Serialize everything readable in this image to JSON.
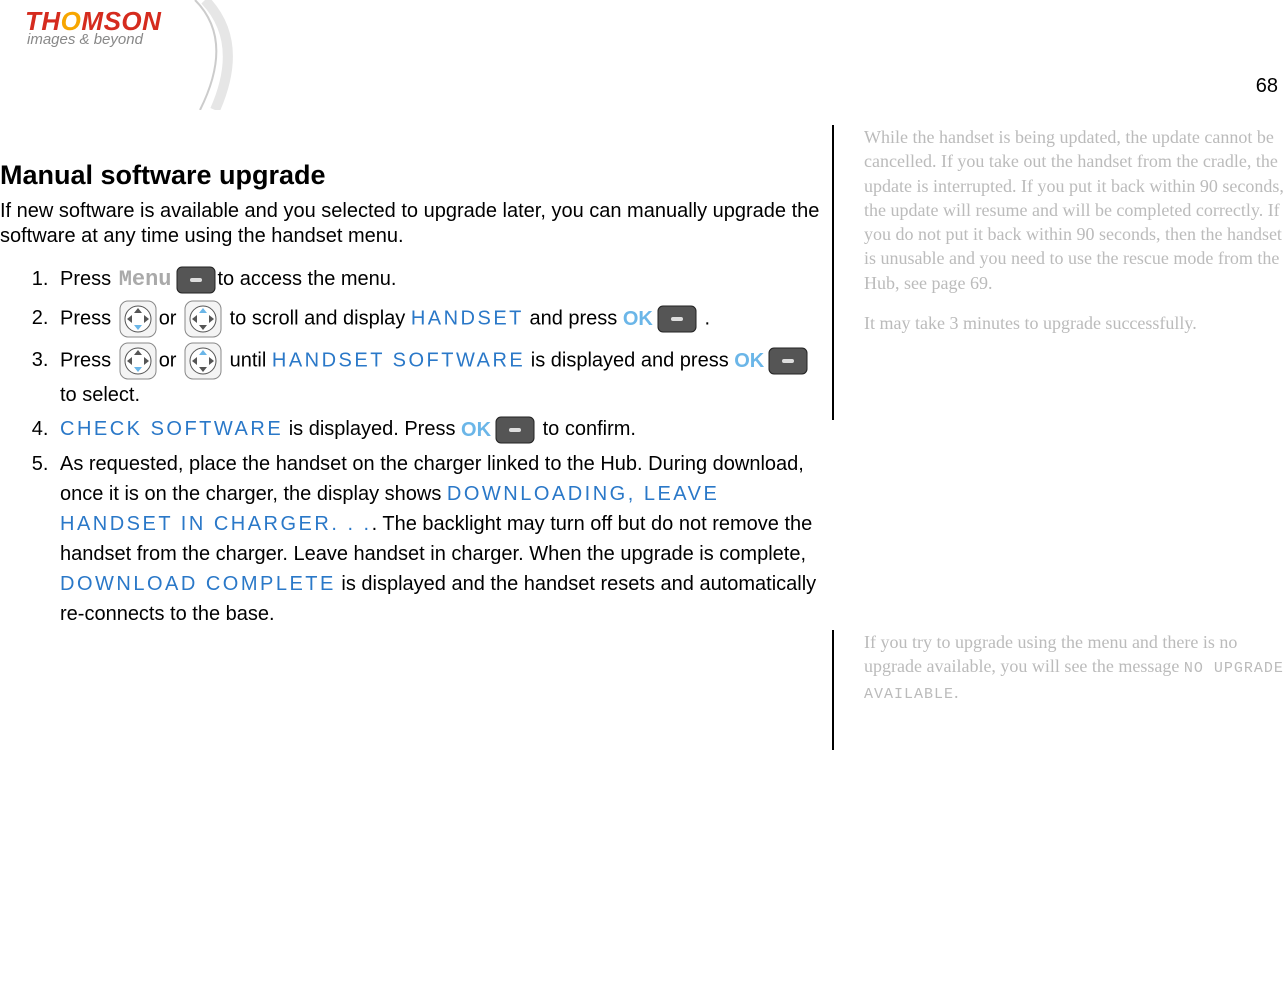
{
  "page_number": "68",
  "logo": {
    "brand": "THOMSON",
    "tagline": "images & beyond"
  },
  "title": "Manual software upgrade",
  "intro": "If new software is available and you selected to upgrade later, you can manually upgrade the software at any time using the handset menu.",
  "labels": {
    "menu": "Menu",
    "ok": "OK",
    "press": "Press",
    "or": "or",
    "to_access_menu": "to access the menu.",
    "to_scroll_display": "to scroll and display",
    "and_press": "and press",
    "period": ".",
    "until": "until",
    "is_displayed_press": "is displayed and press",
    "to_select": "to select.",
    "is_displayed_press2": "is displayed.  Press",
    "to_confirm": "to confirm.",
    "step5_a": "As requested, place the handset on the charger linked to the Hub. During download, once it is on the charger, the display shows",
    "step5_b": ".  The backlight may turn off but do not remove the handset from the charger. Leave handset in charger.  When the upgrade is complete,",
    "step5_c": "is displayed and the handset resets and automatically re-connects to the base."
  },
  "screen_text": {
    "handset": "HANDSET",
    "handset_software": "HANDSET SOFTWARE",
    "check_software": "CHECK SOFTWARE",
    "downloading": "DOWNLOADING, LEAVE HANDSET IN CHARGER. . .",
    "download_complete": "DOWNLOAD COMPLETE",
    "no_upgrade": "NO UPGRADE AVAILABLE"
  },
  "side_notes": {
    "note1": "While the handset is being updated, the update cannot be cancelled. If you take out the handset from the cradle, the update is interrupted. If you put it back within 90 seconds, the update will resume and will be completed correctly. If you do not put it back within 90 seconds, then the handset is unusable and you need to use the rescue mode from the Hub, see page 69.",
    "note2": "It may take 3 minutes to upgrade successfully.",
    "note3_a": "If you try to upgrade using the menu and there is no upgrade available, you will see the message ",
    "note3_b": "."
  }
}
